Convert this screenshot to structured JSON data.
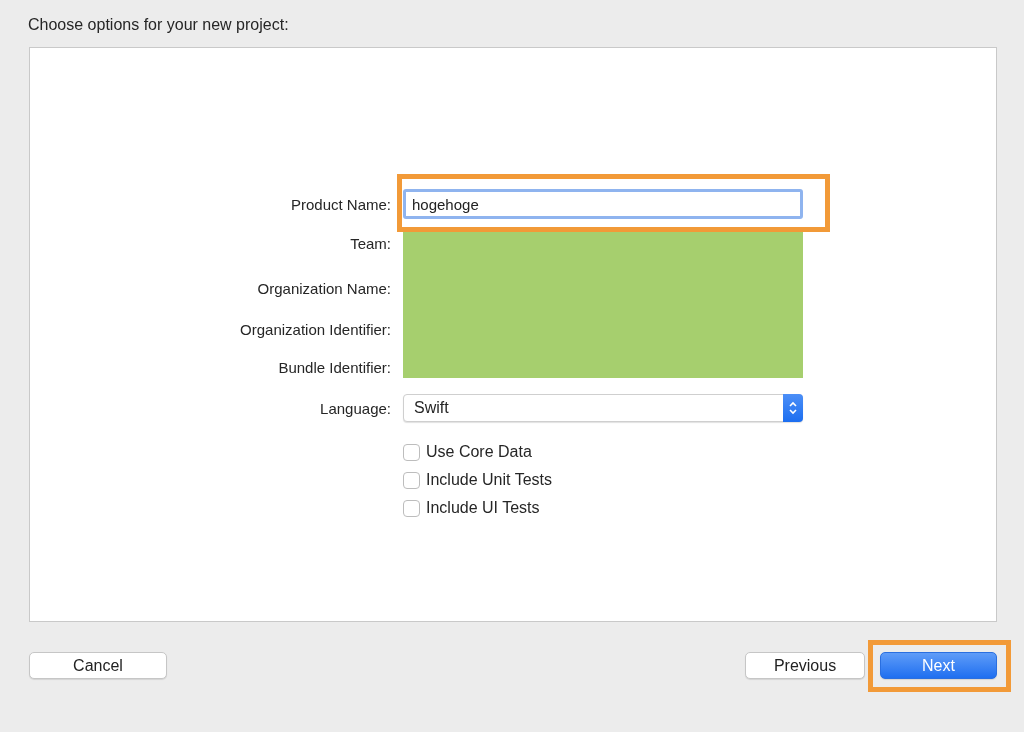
{
  "heading": "Choose options for your new project:",
  "product_name": {
    "label": "Product Name:",
    "value": "hogehoge",
    "focused": true,
    "annotated": true
  },
  "redacted_fields": [
    {
      "label": "Team:"
    },
    {
      "label": "Organization Name:"
    },
    {
      "label": "Organization Identifier:"
    },
    {
      "label": "Bundle Identifier:"
    }
  ],
  "language": {
    "label": "Language:",
    "value": "Swift"
  },
  "options": [
    {
      "label": "Use Core Data",
      "checked": false
    },
    {
      "label": "Include Unit Tests",
      "checked": false
    },
    {
      "label": "Include UI Tests",
      "checked": false
    }
  ],
  "buttons": [
    {
      "label": "Cancel",
      "kind": "plain",
      "annotated": false
    },
    {
      "label": "Previous",
      "kind": "plain",
      "annotated": false
    },
    {
      "label": "Next",
      "kind": "primary",
      "annotated": true
    }
  ]
}
